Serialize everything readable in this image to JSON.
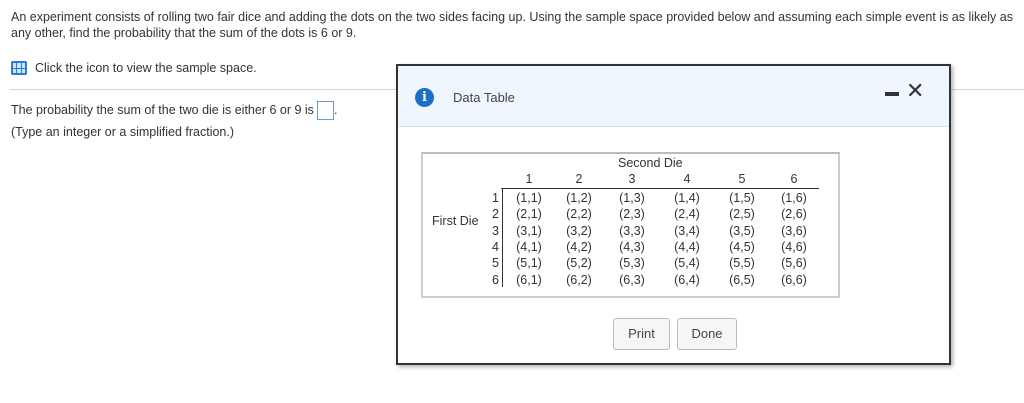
{
  "question": "An experiment consists of rolling two fair dice and adding the dots on the two sides facing up. Using the sample space provided below and assuming each simple event is as likely as any other, find the probability that the sum of the dots is 6 or 9.",
  "hint": "Click the icon to view the sample space.",
  "prompt": "The probability the sum of the two die is either 6 or 9 is",
  "prompt_end": ".",
  "answer_value": "",
  "instructions": "(Type an integer or a simplified fraction.)",
  "dialog": {
    "title": "Data Table",
    "table": {
      "col_header": "Second Die",
      "row_header": "First Die",
      "columns": [
        "1",
        "2",
        "3",
        "4",
        "5",
        "6"
      ],
      "rows": [
        "1",
        "2",
        "3",
        "4",
        "5",
        "6"
      ],
      "cells": [
        [
          "(1,1)",
          "(1,2)",
          "(1,3)",
          "(1,4)",
          "(1,5)",
          "(1,6)"
        ],
        [
          "(2,1)",
          "(2,2)",
          "(2,3)",
          "(2,4)",
          "(2,5)",
          "(2,6)"
        ],
        [
          "(3,1)",
          "(3,2)",
          "(3,3)",
          "(3,4)",
          "(3,5)",
          "(3,6)"
        ],
        [
          "(4,1)",
          "(4,2)",
          "(4,3)",
          "(4,4)",
          "(4,5)",
          "(4,6)"
        ],
        [
          "(5,1)",
          "(5,2)",
          "(5,3)",
          "(5,4)",
          "(5,5)",
          "(5,6)"
        ],
        [
          "(6,1)",
          "(6,2)",
          "(6,3)",
          "(6,4)",
          "(6,5)",
          "(6,6)"
        ]
      ]
    },
    "print_label": "Print",
    "done_label": "Done"
  }
}
